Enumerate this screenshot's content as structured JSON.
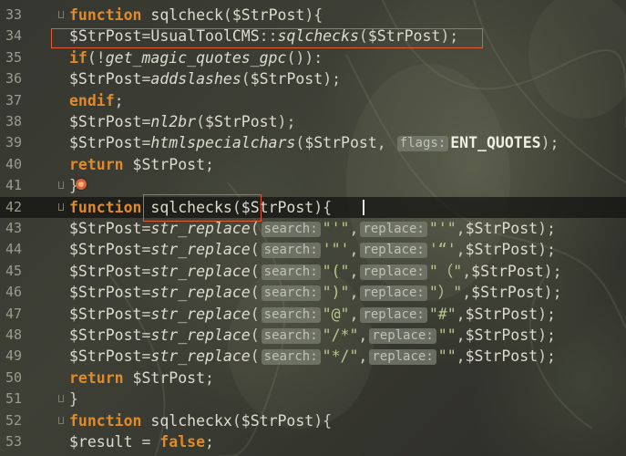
{
  "editor": {
    "lines": [
      {
        "num": "33",
        "current": false,
        "fold": true,
        "tokens": [
          {
            "t": "function",
            "c": "kw"
          },
          {
            "t": " ",
            "c": "punc"
          },
          {
            "t": "sqlcheck",
            "c": "var"
          },
          {
            "t": "(",
            "c": "punc"
          },
          {
            "t": "$StrPost",
            "c": "var"
          },
          {
            "t": "){",
            "c": "punc"
          }
        ]
      },
      {
        "num": "34",
        "current": false,
        "tokens": [
          {
            "t": "$StrPost",
            "c": "var"
          },
          {
            "t": "=",
            "c": "punc"
          },
          {
            "t": "UsualToolCMS",
            "c": "class"
          },
          {
            "t": "::",
            "c": "punc"
          },
          {
            "t": "sqlchecks",
            "c": "fn-italic"
          },
          {
            "t": "(",
            "c": "punc"
          },
          {
            "t": "$StrPost",
            "c": "var"
          },
          {
            "t": ");",
            "c": "punc"
          }
        ]
      },
      {
        "num": "35",
        "current": false,
        "tokens": [
          {
            "t": "if",
            "c": "kw"
          },
          {
            "t": "(!",
            "c": "punc"
          },
          {
            "t": "get_magic_quotes_gpc",
            "c": "fn-italic"
          },
          {
            "t": "()):",
            "c": "punc"
          }
        ]
      },
      {
        "num": "36",
        "current": false,
        "tokens": [
          {
            "t": "$StrPost",
            "c": "var"
          },
          {
            "t": "=",
            "c": "punc"
          },
          {
            "t": "addslashes",
            "c": "fn-italic"
          },
          {
            "t": "(",
            "c": "punc"
          },
          {
            "t": "$StrPost",
            "c": "var"
          },
          {
            "t": ");",
            "c": "punc"
          }
        ]
      },
      {
        "num": "37",
        "current": false,
        "tokens": [
          {
            "t": "endif",
            "c": "kw"
          },
          {
            "t": ";",
            "c": "punc"
          }
        ]
      },
      {
        "num": "38",
        "current": false,
        "tokens": [
          {
            "t": "$StrPost",
            "c": "var"
          },
          {
            "t": "=",
            "c": "punc"
          },
          {
            "t": "nl2br",
            "c": "fn-italic"
          },
          {
            "t": "(",
            "c": "punc"
          },
          {
            "t": "$StrPost",
            "c": "var"
          },
          {
            "t": ");",
            "c": "punc"
          }
        ]
      },
      {
        "num": "39",
        "current": false,
        "tokens": [
          {
            "t": "$StrPost",
            "c": "var"
          },
          {
            "t": "=",
            "c": "punc"
          },
          {
            "t": "htmlspecialchars",
            "c": "fn-italic"
          },
          {
            "t": "(",
            "c": "punc"
          },
          {
            "t": "$StrPost",
            "c": "var"
          },
          {
            "t": ", ",
            "c": "punc"
          },
          {
            "t": "flags:",
            "c": "hint"
          },
          {
            "t": "ENT_QUOTES",
            "c": "const"
          },
          {
            "t": ");",
            "c": "punc"
          }
        ]
      },
      {
        "num": "40",
        "current": false,
        "tokens": [
          {
            "t": "return",
            "c": "kw"
          },
          {
            "t": " ",
            "c": "punc"
          },
          {
            "t": "$StrPost",
            "c": "var"
          },
          {
            "t": ";",
            "c": "punc"
          }
        ]
      },
      {
        "num": "41",
        "current": false,
        "fold": true,
        "breakpoint": true,
        "tokens": [
          {
            "t": "}",
            "c": "punc"
          }
        ]
      },
      {
        "num": "42",
        "current": true,
        "fold": true,
        "caret": true,
        "tokens": [
          {
            "t": "function",
            "c": "kw"
          },
          {
            "t": " ",
            "c": "punc"
          },
          {
            "t": "sqlchecks",
            "c": "var"
          },
          {
            "t": "(",
            "c": "punc"
          },
          {
            "t": "$StrPost",
            "c": "var"
          },
          {
            "t": "){",
            "c": "punc"
          }
        ]
      },
      {
        "num": "43",
        "current": false,
        "tokens": [
          {
            "t": "$StrPost",
            "c": "var"
          },
          {
            "t": "=",
            "c": "punc"
          },
          {
            "t": "str_replace",
            "c": "fn-italic"
          },
          {
            "t": "(",
            "c": "punc"
          },
          {
            "t": "search:",
            "c": "hint"
          },
          {
            "t": "\"'\"",
            "c": "str"
          },
          {
            "t": ",",
            "c": "punc"
          },
          {
            "t": "replace:",
            "c": "hint"
          },
          {
            "t": "\"'\"",
            "c": "str"
          },
          {
            "t": ",",
            "c": "punc"
          },
          {
            "t": "$StrPost",
            "c": "var"
          },
          {
            "t": ");",
            "c": "punc"
          }
        ]
      },
      {
        "num": "44",
        "current": false,
        "tokens": [
          {
            "t": "$StrPost",
            "c": "var"
          },
          {
            "t": "=",
            "c": "punc"
          },
          {
            "t": "str_replace",
            "c": "fn-italic"
          },
          {
            "t": "(",
            "c": "punc"
          },
          {
            "t": "search:",
            "c": "hint"
          },
          {
            "t": "'\"'",
            "c": "str"
          },
          {
            "t": ",",
            "c": "punc"
          },
          {
            "t": "replace:",
            "c": "hint"
          },
          {
            "t": "'“'",
            "c": "str"
          },
          {
            "t": ",",
            "c": "punc"
          },
          {
            "t": "$StrPost",
            "c": "var"
          },
          {
            "t": ");",
            "c": "punc"
          }
        ]
      },
      {
        "num": "45",
        "current": false,
        "tokens": [
          {
            "t": "$StrPost",
            "c": "var"
          },
          {
            "t": "=",
            "c": "punc"
          },
          {
            "t": "str_replace",
            "c": "fn-italic"
          },
          {
            "t": "(",
            "c": "punc"
          },
          {
            "t": "search:",
            "c": "hint"
          },
          {
            "t": "\"(\"",
            "c": "str"
          },
          {
            "t": ",",
            "c": "punc"
          },
          {
            "t": "replace:",
            "c": "hint"
          },
          {
            "t": "\"（\"",
            "c": "str"
          },
          {
            "t": ",",
            "c": "punc"
          },
          {
            "t": "$StrPost",
            "c": "var"
          },
          {
            "t": ");",
            "c": "punc"
          }
        ]
      },
      {
        "num": "46",
        "current": false,
        "tokens": [
          {
            "t": "$StrPost",
            "c": "var"
          },
          {
            "t": "=",
            "c": "punc"
          },
          {
            "t": "str_replace",
            "c": "fn-italic"
          },
          {
            "t": "(",
            "c": "punc"
          },
          {
            "t": "search:",
            "c": "hint"
          },
          {
            "t": "\")\"",
            "c": "str"
          },
          {
            "t": ",",
            "c": "punc"
          },
          {
            "t": "replace:",
            "c": "hint"
          },
          {
            "t": "\"）\"",
            "c": "str"
          },
          {
            "t": ",",
            "c": "punc"
          },
          {
            "t": "$StrPost",
            "c": "var"
          },
          {
            "t": ");",
            "c": "punc"
          }
        ]
      },
      {
        "num": "47",
        "current": false,
        "tokens": [
          {
            "t": "$StrPost",
            "c": "var"
          },
          {
            "t": "=",
            "c": "punc"
          },
          {
            "t": "str_replace",
            "c": "fn-italic"
          },
          {
            "t": "(",
            "c": "punc"
          },
          {
            "t": "search:",
            "c": "hint"
          },
          {
            "t": "\"@\"",
            "c": "str"
          },
          {
            "t": ",",
            "c": "punc"
          },
          {
            "t": "replace:",
            "c": "hint"
          },
          {
            "t": "\"#\"",
            "c": "str"
          },
          {
            "t": ",",
            "c": "punc"
          },
          {
            "t": "$StrPost",
            "c": "var"
          },
          {
            "t": ");",
            "c": "punc"
          }
        ]
      },
      {
        "num": "48",
        "current": false,
        "tokens": [
          {
            "t": "$StrPost",
            "c": "var"
          },
          {
            "t": "=",
            "c": "punc"
          },
          {
            "t": "str_replace",
            "c": "fn-italic"
          },
          {
            "t": "(",
            "c": "punc"
          },
          {
            "t": "search:",
            "c": "hint"
          },
          {
            "t": "\"/*\"",
            "c": "str"
          },
          {
            "t": ",",
            "c": "punc"
          },
          {
            "t": "replace:",
            "c": "hint"
          },
          {
            "t": "\"\"",
            "c": "str"
          },
          {
            "t": ",",
            "c": "punc"
          },
          {
            "t": "$StrPost",
            "c": "var"
          },
          {
            "t": ");",
            "c": "punc"
          }
        ]
      },
      {
        "num": "49",
        "current": false,
        "tokens": [
          {
            "t": "$StrPost",
            "c": "var"
          },
          {
            "t": "=",
            "c": "punc"
          },
          {
            "t": "str_replace",
            "c": "fn-italic"
          },
          {
            "t": "(",
            "c": "punc"
          },
          {
            "t": "search:",
            "c": "hint"
          },
          {
            "t": "\"*/\"",
            "c": "str"
          },
          {
            "t": ",",
            "c": "punc"
          },
          {
            "t": "replace:",
            "c": "hint"
          },
          {
            "t": "\"\"",
            "c": "str"
          },
          {
            "t": ",",
            "c": "punc"
          },
          {
            "t": "$StrPost",
            "c": "var"
          },
          {
            "t": ");",
            "c": "punc"
          }
        ]
      },
      {
        "num": "50",
        "current": false,
        "tokens": [
          {
            "t": "return",
            "c": "kw"
          },
          {
            "t": " ",
            "c": "punc"
          },
          {
            "t": "$StrPost",
            "c": "var"
          },
          {
            "t": ";",
            "c": "punc"
          }
        ]
      },
      {
        "num": "51",
        "current": false,
        "fold": true,
        "tokens": [
          {
            "t": "}",
            "c": "punc"
          }
        ]
      },
      {
        "num": "52",
        "current": false,
        "fold": true,
        "tokens": [
          {
            "t": "function",
            "c": "kw"
          },
          {
            "t": " ",
            "c": "punc"
          },
          {
            "t": "sqlcheckx",
            "c": "var"
          },
          {
            "t": "(",
            "c": "punc"
          },
          {
            "t": "$StrPost",
            "c": "var"
          },
          {
            "t": "){",
            "c": "punc"
          }
        ]
      },
      {
        "num": "53",
        "current": false,
        "tokens": [
          {
            "t": "$result",
            "c": "var"
          },
          {
            "t": " = ",
            "c": "punc"
          },
          {
            "t": "false",
            "c": "kw"
          },
          {
            "t": ";",
            "c": "punc"
          }
        ]
      }
    ]
  },
  "colors": {
    "keyword": "#e08a2a",
    "highlight_box": "#e25a36",
    "breakpoint": "#d8643c",
    "hint_bg": "#787c70"
  },
  "icons": [
    "fold-marker-icon",
    "breakpoint-bulb-icon"
  ]
}
